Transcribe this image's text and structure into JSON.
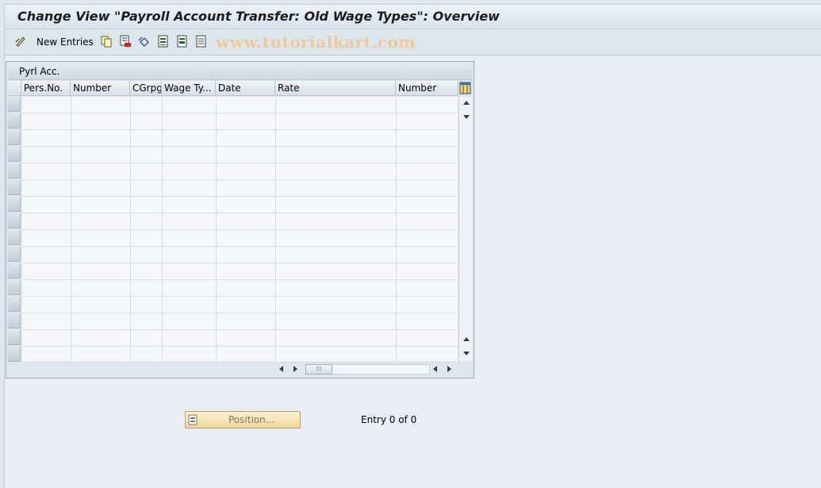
{
  "window": {
    "title": "Change View \"Payroll Account Transfer: Old Wage Types\": Overview"
  },
  "toolbar": {
    "new_entries_label": "New Entries",
    "icons": [
      "display-change-icon",
      "copy-icon",
      "delete-icon",
      "undo-icon",
      "select-all-icon",
      "select-block-icon",
      "deselect-all-icon"
    ]
  },
  "watermark": "www.tutorialkart.com",
  "table": {
    "title": "Pyrl Acc.",
    "columns": [
      "Pers.No.",
      "Number",
      "CGrpg",
      "Wage Ty...",
      "Date",
      "Rate",
      "Number"
    ],
    "rows": []
  },
  "footer": {
    "position_button_label": "Position...",
    "entry_text": "Entry 0 of 0"
  },
  "colors": {
    "background": "#dfe6ee",
    "button": "#f0d89c",
    "watermark": "#f0c89a"
  }
}
